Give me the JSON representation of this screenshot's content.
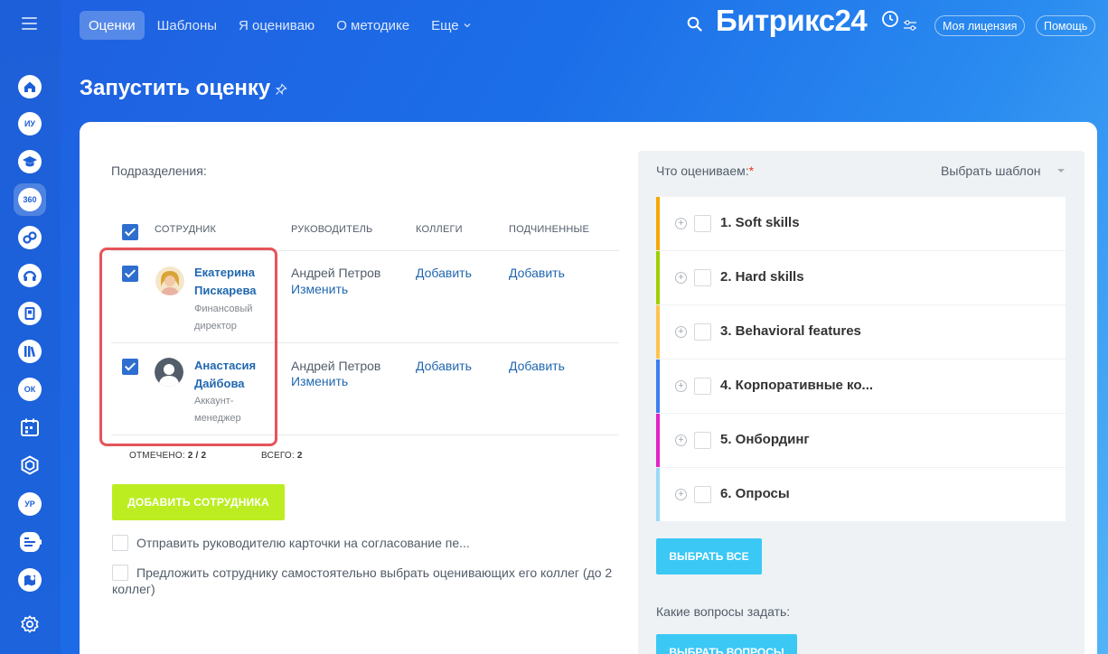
{
  "nav": {
    "tabs": [
      "Оценки",
      "Шаблоны",
      "Я оцениваю",
      "О методике",
      "Еще"
    ],
    "active_tab": 0,
    "logo": "Битрикс24",
    "license_btn": "Моя лицензия",
    "help_btn": "Помощь"
  },
  "sidebar": {
    "items": [
      {
        "icon": "home-icon",
        "label": ""
      },
      {
        "icon": "avatar-initials-icon",
        "label": "ИУ"
      },
      {
        "icon": "graduation-cap-icon",
        "label": ""
      },
      {
        "icon": "360-icon",
        "label": "360"
      },
      {
        "icon": "chain-icon",
        "label": ""
      },
      {
        "icon": "headset-icon",
        "label": ""
      },
      {
        "icon": "book-icon",
        "label": ""
      },
      {
        "icon": "library-icon",
        "label": ""
      },
      {
        "icon": "ok-badge-icon",
        "label": "ОК"
      },
      {
        "icon": "calendar-icon",
        "label": ""
      },
      {
        "icon": "hexagon-icon",
        "label": ""
      },
      {
        "icon": "avatar-initials-icon",
        "label": "УР"
      },
      {
        "icon": "checklist-icon",
        "label": ""
      },
      {
        "icon": "map-icon",
        "label": ""
      },
      {
        "icon": "gear-icon",
        "label": ""
      }
    ]
  },
  "page": {
    "title": "Запустить оценку"
  },
  "left": {
    "subdivisions_label": "Подразделения:",
    "table": {
      "headers": [
        "СОТРУДНИК",
        "РУКОВОДИТЕЛЬ",
        "КОЛЛЕГИ",
        "ПОДЧИНЕННЫЕ"
      ],
      "rows": [
        {
          "name_line1": "Екатерина",
          "name_line2": "Пискарева",
          "position_line1": "Финансовый",
          "position_line2": "директор",
          "manager": "Андрей Петров",
          "change": "Изменить",
          "colleagues": "Добавить",
          "subordinates": "Добавить"
        },
        {
          "name_line1": "Анастасия",
          "name_line2": "Дайбова",
          "position_line1": "Аккаунт-",
          "position_line2": "менеджер",
          "manager": "Андрей Петров",
          "change": "Изменить",
          "colleagues": "Добавить",
          "subordinates": "Добавить"
        }
      ],
      "marked_label": "ОТМЕЧЕНО:",
      "marked_value": "2 / 2",
      "total_label": "ВСЕГО:",
      "total_value": "2"
    },
    "add_employee_btn": "ДОБАВИТЬ СОТРУДНИКА",
    "option1": "Отправить руководителю карточки на согласование пе...",
    "option2_line1": "Предложить сотруднику самостоятельно выбрать оценивающих его коллег (до 2",
    "option2_line2": "коллег)"
  },
  "right": {
    "what_label": "Что оцениваем:",
    "required_mark": "*",
    "template_select": "Выбрать шаблон",
    "categories": [
      {
        "title": "1. Soft skills",
        "color": "#f7a700"
      },
      {
        "title": "2. Hard skills",
        "color": "#9dcf00"
      },
      {
        "title": "3. Behavioral features",
        "color": "#ffc34d"
      },
      {
        "title": "4. Корпоративные ко...",
        "color": "#3d7ef0"
      },
      {
        "title": "5. Онбординг",
        "color": "#e323c8"
      },
      {
        "title": "6. Опросы",
        "color": "#9dd9f5"
      }
    ],
    "select_all_btn": "ВЫБРАТЬ ВСЕ",
    "questions_label": "Какие вопросы задать:",
    "questions_btn": "ВЫБРАТЬ ВОПРОСЫ"
  }
}
